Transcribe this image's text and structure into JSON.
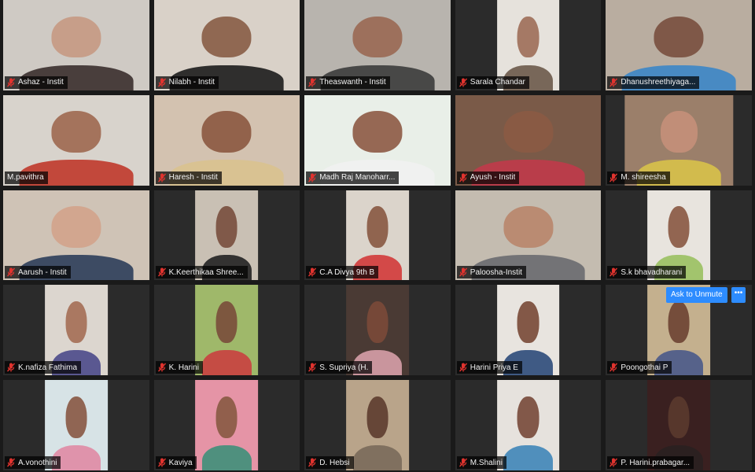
{
  "participants": [
    {
      "name": "Ashaz - Instit",
      "muted": true,
      "bg": "#cfcac4",
      "skin": "#c79a83",
      "shirt": "#3a2f2e",
      "frame": "full"
    },
    {
      "name": "Nilabh - Instit",
      "muted": true,
      "bg": "#d9d1c8",
      "skin": "#8a5e48",
      "shirt": "#1c1c1c",
      "frame": "full"
    },
    {
      "name": "Theaswanth - Instit",
      "muted": true,
      "bg": "#b8b4ae",
      "skin": "#9a6a55",
      "shirt": "#3c3c3c",
      "frame": "full"
    },
    {
      "name": "Sarala Chandar",
      "muted": true,
      "bg": "#e6e2dc",
      "skin": "#a0705a",
      "shirt": "#6b5a4a",
      "frame": "narrow"
    },
    {
      "name": "Dhanushreethiyaga...",
      "muted": true,
      "bg": "#b9ada0",
      "skin": "#7a5040",
      "shirt": "#3c86c6",
      "frame": "full"
    },
    {
      "name": "M.pavithra",
      "muted": false,
      "bg": "#d8d3cc",
      "skin": "#a06a52",
      "shirt": "#c0392b",
      "frame": "full",
      "active": true
    },
    {
      "name": "Haresh - Instit",
      "muted": true,
      "bg": "#d3c2b0",
      "skin": "#8c5a42",
      "shirt": "#d9c28f",
      "frame": "full"
    },
    {
      "name": "Madh Raj Manoharr...",
      "muted": true,
      "bg": "#e9efe8",
      "skin": "#8e5c46",
      "shirt": "#f1f1f1",
      "frame": "full"
    },
    {
      "name": "Ayush - Instit",
      "muted": true,
      "bg": "#7a5a48",
      "skin": "#8a5a44",
      "shirt": "#c03a4a",
      "frame": "full"
    },
    {
      "name": "M. shireesha",
      "muted": true,
      "bg": "#9b7f6a",
      "skin": "#c48f7a",
      "shirt": "#d8c24a",
      "frame": "medium"
    },
    {
      "name": "Aarush - Instit",
      "muted": true,
      "bg": "#cfc3b6",
      "skin": "#d2a48c",
      "shirt": "#2c3e5a",
      "frame": "full"
    },
    {
      "name": "K.Keerthikaa Shree...",
      "muted": true,
      "bg": "#c9c0b4",
      "skin": "#7a5040",
      "shirt": "#222222",
      "frame": "narrow"
    },
    {
      "name": "C.A Divya 9th B",
      "muted": true,
      "bg": "#dbd4cb",
      "skin": "#8a5a44",
      "shirt": "#d23a3a",
      "frame": "narrow"
    },
    {
      "name": "Paloosha-Instit",
      "muted": true,
      "bg": "#c4bcb0",
      "skin": "#b9876c",
      "shirt": "#6a6a70",
      "frame": "full"
    },
    {
      "name": "S.k bhavadharani",
      "muted": true,
      "bg": "#e8e4de",
      "skin": "#8a5a44",
      "shirt": "#9ac060",
      "frame": "narrow"
    },
    {
      "name": "K.nafiza Fathima",
      "muted": true,
      "bg": "#dcd6cf",
      "skin": "#a57058",
      "shirt": "#4b4a8a",
      "frame": "narrow"
    },
    {
      "name": "K. Harini",
      "muted": true,
      "bg": "#9fb86a",
      "skin": "#7a4e3c",
      "shirt": "#c94040",
      "frame": "narrow"
    },
    {
      "name": "S. Supriya (H.",
      "muted": true,
      "bg": "#4a3a34",
      "skin": "#7a4a38",
      "shirt": "#d7a0a8",
      "frame": "narrow"
    },
    {
      "name": "Harini Priya E",
      "muted": true,
      "bg": "#e8e4df",
      "skin": "#7a4c3a",
      "shirt": "#2c4a7a",
      "frame": "narrow"
    },
    {
      "name": "Poongothai P",
      "muted": true,
      "bg": "#c4b08e",
      "skin": "#6e4434",
      "shirt": "#4a5a8a",
      "frame": "narrow"
    },
    {
      "name": "A.vonothini",
      "muted": true,
      "bg": "#d7e3e6",
      "skin": "#8a5a46",
      "shirt": "#e08aa4",
      "frame": "narrow"
    },
    {
      "name": "Kaviya",
      "muted": true,
      "bg": "#e594a6",
      "skin": "#8a5a44",
      "shirt": "#3e8f7a",
      "frame": "narrow"
    },
    {
      "name": "D. Hebsi",
      "muted": true,
      "bg": "#b9a48a",
      "skin": "#5e3e30",
      "shirt": "#7a6a5a",
      "frame": "narrow"
    },
    {
      "name": "M.Shalini",
      "muted": true,
      "bg": "#e6e2dd",
      "skin": "#7a4c3c",
      "shirt": "#3f86b8",
      "frame": "narrow"
    },
    {
      "name": "P. Harini.prabagar...",
      "muted": true,
      "bg": "#3a2020",
      "skin": "#5a3a2e",
      "shirt": "#2a2020",
      "frame": "narrow"
    }
  ],
  "controls": {
    "ask_to_unmute": "Ask to Unmute",
    "more": "•••"
  },
  "colors": {
    "mic_muted": "#e0332e",
    "active_speaker": "#d7e35a",
    "accent": "#2d8cff"
  }
}
